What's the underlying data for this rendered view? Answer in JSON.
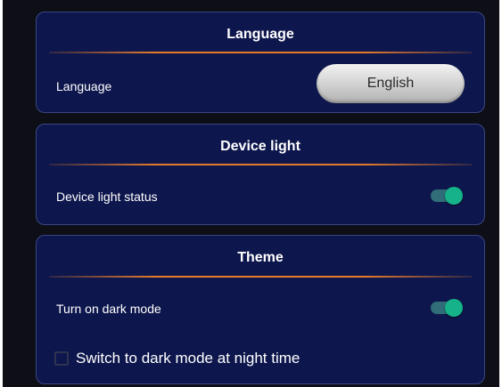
{
  "language_section": {
    "title": "Language",
    "row_label": "Language",
    "selected_language": "English"
  },
  "device_light_section": {
    "title": "Device light",
    "row_label": "Device light status",
    "toggle_on": true
  },
  "theme_section": {
    "title": "Theme",
    "dark_mode_label": "Turn on dark mode",
    "dark_mode_on": true,
    "night_switch_label": "Switch to dark mode at night time",
    "night_switch_checked": false
  },
  "colors": {
    "card_background": "#0e174d",
    "divider_accent": "#e57a2b",
    "toggle_on": "#16b38a"
  }
}
